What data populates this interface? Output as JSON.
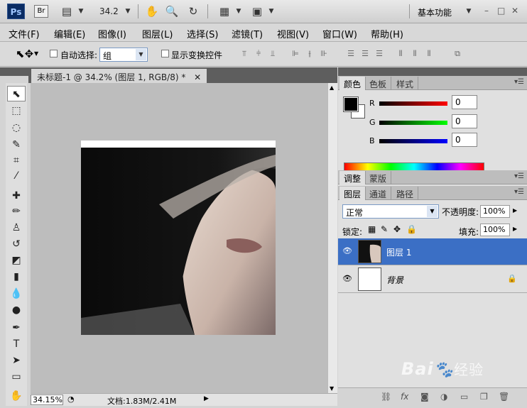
{
  "app": {
    "logo": "Ps",
    "bridge": "Br",
    "zoom_field": "34.2",
    "workspace": "基本功能"
  },
  "menu": [
    "文件(F)",
    "编辑(E)",
    "图像(I)",
    "图层(L)",
    "选择(S)",
    "滤镜(T)",
    "视图(V)",
    "窗口(W)",
    "帮助(H)"
  ],
  "options": {
    "auto_select_label": "自动选择:",
    "auto_select_value": "组",
    "show_transform_label": "显示变换控件"
  },
  "document": {
    "tab_title": "未标题-1 @ 34.2% (图层 1, RGB/8) *",
    "zoom_status": "34.15%",
    "doc_info": "文档:1.83M/2.41M"
  },
  "color_panel": {
    "tabs": [
      "颜色",
      "色板",
      "样式"
    ],
    "r_label": "R",
    "r_value": "0",
    "g_label": "G",
    "g_value": "0",
    "b_label": "B",
    "b_value": "0",
    "foreground": "#000000",
    "background": "#ffffff"
  },
  "adjust_panel": {
    "tabs": [
      "调整",
      "蒙版"
    ]
  },
  "layers_panel": {
    "tabs": [
      "图层",
      "通道",
      "路径"
    ],
    "blend_mode": "正常",
    "opacity_label": "不透明度:",
    "opacity_value": "100%",
    "lock_label": "锁定:",
    "fill_label": "填充:",
    "fill_value": "100%",
    "layers": [
      {
        "name": "图层 1",
        "selected": true
      },
      {
        "name": "背景",
        "selected": false,
        "locked": true
      }
    ]
  },
  "watermark": {
    "brand": "Bai",
    "suffix": "经验"
  }
}
